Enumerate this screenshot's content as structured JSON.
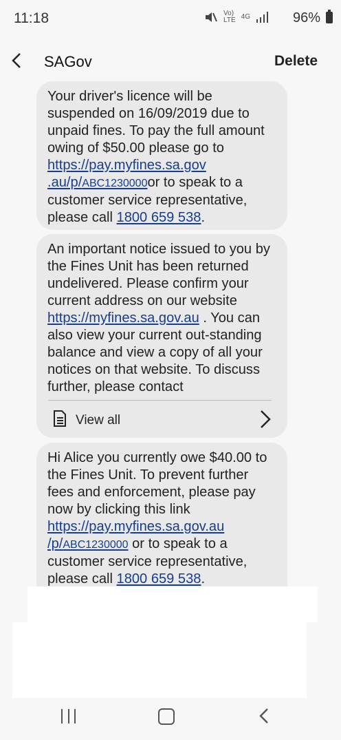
{
  "status": {
    "time": "11:18",
    "network": "4G",
    "battery": "96%"
  },
  "header": {
    "title": "SAGov",
    "delete_label": "Delete"
  },
  "messages": [
    {
      "pre_link": "Your driver's licence will be suspended on 16/09/2019 due to unpaid fines. To pay the full amount owing of $50.00 please go to ",
      "link1_main": "https://pay.myfines.sa.gov",
      "link1_cont": ".au/p/",
      "link1_code": "ABC1230000",
      "after_link": "or to speak to a customer service representative, please call ",
      "phone": "1800 659 538",
      "end": "."
    },
    {
      "text_before": "An important notice issued to you by the Fines Unit has been returned undelivered. Please confirm your current address on our website ",
      "link": "https://myfines.sa.gov.au",
      "text_after": " . You can also view your current out-standing balance and view a copy of all your notices on that website. To discuss further, please contact",
      "view_all": "View all"
    },
    {
      "pre_link": "Hi Alice you currently owe $40.00 to the Fines Unit. To prevent further fees and enforcement, please pay now by clicking this link ",
      "link_main": "https://pay.myfines.sa.gov.au",
      "link_cont": "/p/",
      "link_code": "ABC1230000",
      "after_link": " or to speak to a customer service representative, please call ",
      "phone": "1800 659 538",
      "end": "."
    }
  ]
}
